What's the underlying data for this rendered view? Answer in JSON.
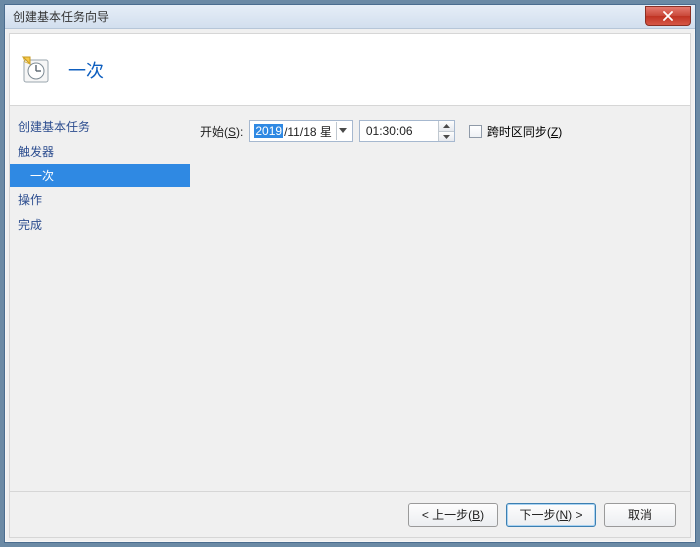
{
  "window": {
    "title": "创建基本任务向导"
  },
  "header": {
    "title": "一次"
  },
  "sidebar": {
    "items": [
      {
        "label": "创建基本任务",
        "type": "item"
      },
      {
        "label": "触发器",
        "type": "item"
      },
      {
        "label": "一次",
        "type": "sub",
        "selected": true
      },
      {
        "label": "操作",
        "type": "item"
      },
      {
        "label": "完成",
        "type": "item"
      }
    ]
  },
  "main": {
    "start_label_prefix": "开始(",
    "start_label_hotkey": "S",
    "start_label_suffix": "):",
    "date_year": "2019",
    "date_rest": "/11/18 星",
    "time_value": "01:30:06",
    "sync_label_prefix": "跨时区同步(",
    "sync_label_hotkey": "Z",
    "sync_label_suffix": ")",
    "sync_checked": false
  },
  "footer": {
    "back_prefix": "< 上一步(",
    "back_hotkey": "B",
    "back_suffix": ")",
    "next_prefix": "下一步(",
    "next_hotkey": "N",
    "next_suffix": ") >",
    "cancel": "取消"
  },
  "colors": {
    "accent": "#2f89e3",
    "link": "#2c4d8f",
    "close": "#c9493a"
  }
}
